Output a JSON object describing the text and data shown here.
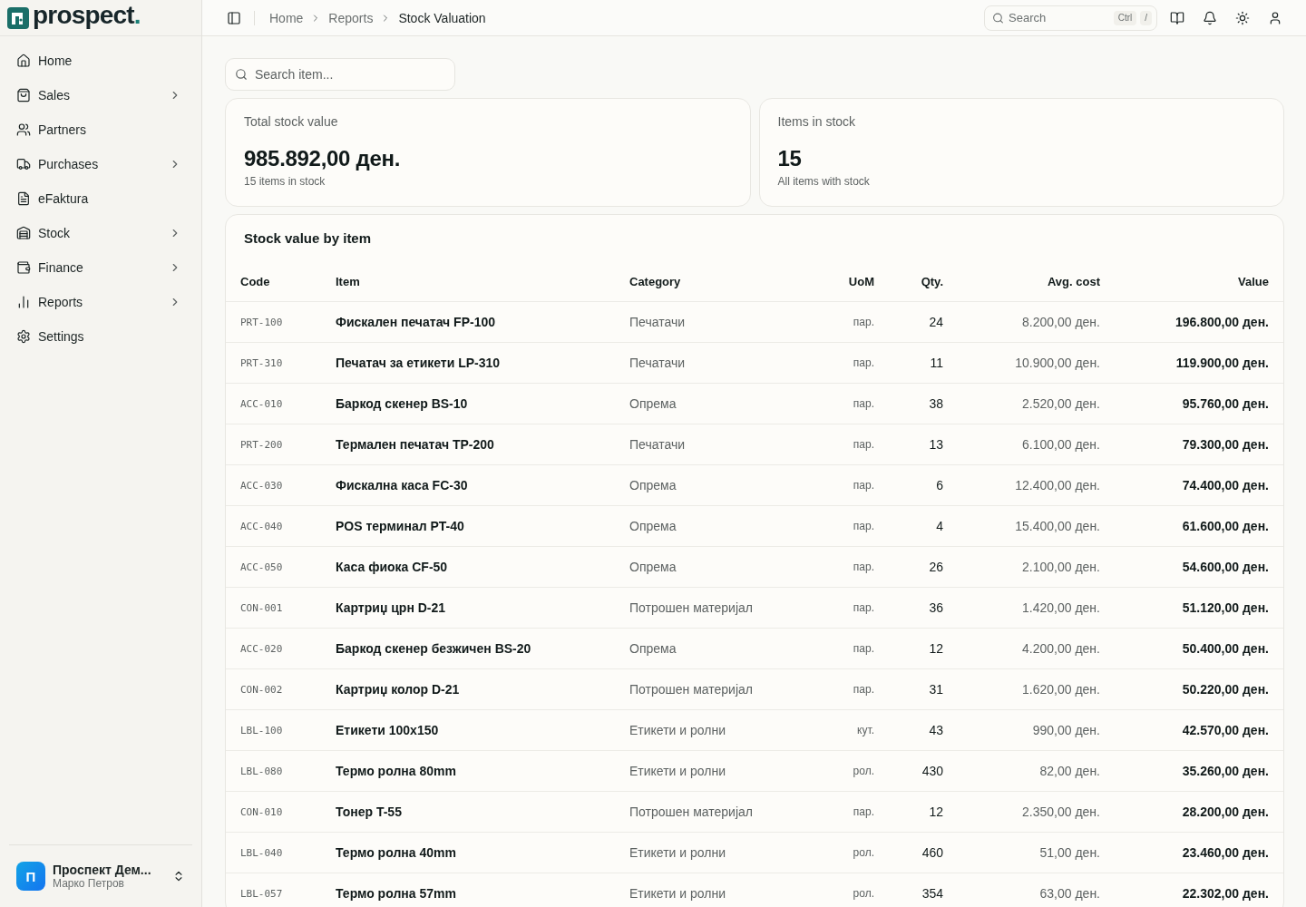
{
  "brand": {
    "name": "prospect",
    "dot": "."
  },
  "sidebar": {
    "items": [
      {
        "label": "Home",
        "has_submenu": false,
        "selected": false
      },
      {
        "label": "Sales",
        "has_submenu": true,
        "selected": false
      },
      {
        "label": "Partners",
        "has_submenu": false,
        "selected": false
      },
      {
        "label": "Purchases",
        "has_submenu": true,
        "selected": false
      },
      {
        "label": "eFaktura",
        "has_submenu": false,
        "selected": false
      },
      {
        "label": "Stock",
        "has_submenu": true,
        "selected": false
      },
      {
        "label": "Finance",
        "has_submenu": true,
        "selected": false
      },
      {
        "label": "Reports",
        "has_submenu": true,
        "selected": false
      },
      {
        "label": "Settings",
        "has_submenu": false,
        "selected": false
      }
    ],
    "account": {
      "initial": "П",
      "organization": "Проспект Дем...",
      "user": "Марко Петров"
    }
  },
  "header": {
    "breadcrumb": [
      "Home",
      "Reports",
      "Stock Valuation"
    ],
    "search": {
      "placeholder": "Search",
      "shortcut": [
        "Ctrl",
        "/"
      ]
    }
  },
  "search": {
    "placeholder": "Search item..."
  },
  "stats": [
    {
      "label": "Total stock value",
      "value": "985.892,00 ден.",
      "note": "15 items in stock"
    },
    {
      "label": "Items in stock",
      "value": "15",
      "note": "All items with stock"
    }
  ],
  "table": {
    "title": "Stock value by item",
    "columns": [
      "Code",
      "Item",
      "Category",
      "UoM",
      "Qty.",
      "Avg. cost",
      "Value"
    ],
    "rows": [
      {
        "code": "PRT-100",
        "item": "Фискален печатач FP-100",
        "category": "Печатачи",
        "uom": "пар.",
        "qty": "24",
        "avg_cost": "8.200,00 ден.",
        "value": "196.800,00 ден."
      },
      {
        "code": "PRT-310",
        "item": "Печатач за етикети LP-310",
        "category": "Печатачи",
        "uom": "пар.",
        "qty": "11",
        "avg_cost": "10.900,00 ден.",
        "value": "119.900,00 ден."
      },
      {
        "code": "ACC-010",
        "item": "Баркод скенер BS-10",
        "category": "Опрема",
        "uom": "пар.",
        "qty": "38",
        "avg_cost": "2.520,00 ден.",
        "value": "95.760,00 ден."
      },
      {
        "code": "PRT-200",
        "item": "Термален печатач TP-200",
        "category": "Печатачи",
        "uom": "пар.",
        "qty": "13",
        "avg_cost": "6.100,00 ден.",
        "value": "79.300,00 ден."
      },
      {
        "code": "ACC-030",
        "item": "Фискална каса FC-30",
        "category": "Опрема",
        "uom": "пар.",
        "qty": "6",
        "avg_cost": "12.400,00 ден.",
        "value": "74.400,00 ден."
      },
      {
        "code": "ACC-040",
        "item": "POS терминал PT-40",
        "category": "Опрема",
        "uom": "пар.",
        "qty": "4",
        "avg_cost": "15.400,00 ден.",
        "value": "61.600,00 ден."
      },
      {
        "code": "ACC-050",
        "item": "Каса фиока CF-50",
        "category": "Опрема",
        "uom": "пар.",
        "qty": "26",
        "avg_cost": "2.100,00 ден.",
        "value": "54.600,00 ден."
      },
      {
        "code": "CON-001",
        "item": "Картриџ црн D-21",
        "category": "Потрошен материјал",
        "uom": "пар.",
        "qty": "36",
        "avg_cost": "1.420,00 ден.",
        "value": "51.120,00 ден."
      },
      {
        "code": "ACC-020",
        "item": "Баркод скенер безжичен BS-20",
        "category": "Опрема",
        "uom": "пар.",
        "qty": "12",
        "avg_cost": "4.200,00 ден.",
        "value": "50.400,00 ден."
      },
      {
        "code": "CON-002",
        "item": "Картриџ колор D-21",
        "category": "Потрошен материјал",
        "uom": "пар.",
        "qty": "31",
        "avg_cost": "1.620,00 ден.",
        "value": "50.220,00 ден."
      },
      {
        "code": "LBL-100",
        "item": "Етикети 100x150",
        "category": "Етикети и ролни",
        "uom": "кут.",
        "qty": "43",
        "avg_cost": "990,00 ден.",
        "value": "42.570,00 ден."
      },
      {
        "code": "LBL-080",
        "item": "Термо ролна 80mm",
        "category": "Етикети и ролни",
        "uom": "рол.",
        "qty": "430",
        "avg_cost": "82,00 ден.",
        "value": "35.260,00 ден."
      },
      {
        "code": "CON-010",
        "item": "Тонер T-55",
        "category": "Потрошен материјал",
        "uom": "пар.",
        "qty": "12",
        "avg_cost": "2.350,00 ден.",
        "value": "28.200,00 ден."
      },
      {
        "code": "LBL-040",
        "item": "Термо ролна 40mm",
        "category": "Етикети и ролни",
        "uom": "рол.",
        "qty": "460",
        "avg_cost": "51,00 ден.",
        "value": "23.460,00 ден."
      },
      {
        "code": "LBL-057",
        "item": "Термо ролна 57mm",
        "category": "Етикети и ролни",
        "uom": "рол.",
        "qty": "354",
        "avg_cost": "63,00 ден.",
        "value": "22.302,00 ден."
      }
    ]
  }
}
